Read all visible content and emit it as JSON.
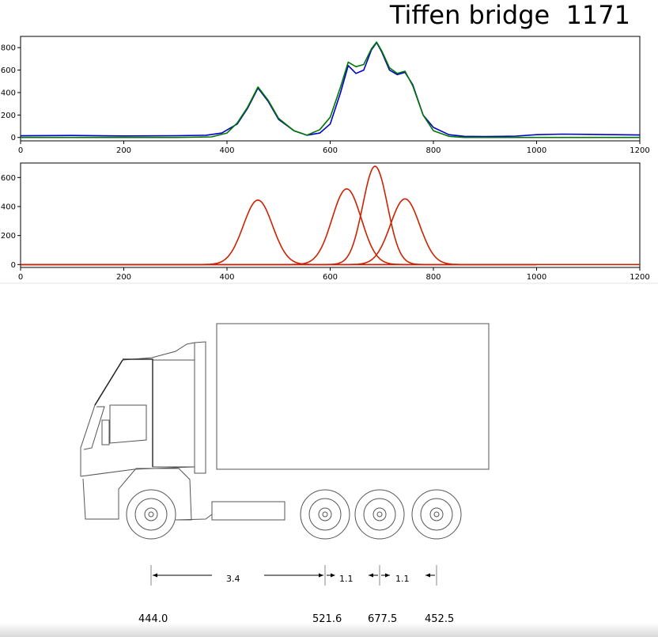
{
  "title": "Tiffen bridge  1171",
  "colors": {
    "measured": "#0000cc",
    "fitted": "#007700",
    "axle": "#cc2200",
    "baseline": "#000099",
    "truck": "#555555"
  },
  "chart_data": [
    {
      "type": "line",
      "xlim": [
        0,
        1200
      ],
      "ylim": [
        -30,
        900
      ],
      "x_ticks": [
        "0",
        "200",
        "400",
        "600",
        "800",
        "1000",
        "1200"
      ],
      "y_ticks": [
        "0",
        "200",
        "400",
        "600",
        "800"
      ],
      "series": [
        {
          "color": "#0000cc",
          "points": [
            [
              0,
              15
            ],
            [
              100,
              18
            ],
            [
              200,
              14
            ],
            [
              300,
              16
            ],
            [
              360,
              20
            ],
            [
              390,
              40
            ],
            [
              420,
              120
            ],
            [
              440,
              260
            ],
            [
              460,
              440
            ],
            [
              480,
              320
            ],
            [
              500,
              160
            ],
            [
              530,
              60
            ],
            [
              555,
              20
            ],
            [
              580,
              40
            ],
            [
              600,
              120
            ],
            [
              620,
              400
            ],
            [
              635,
              640
            ],
            [
              650,
              570
            ],
            [
              665,
              600
            ],
            [
              680,
              780
            ],
            [
              690,
              845
            ],
            [
              700,
              760
            ],
            [
              715,
              600
            ],
            [
              730,
              560
            ],
            [
              745,
              580
            ],
            [
              760,
              470
            ],
            [
              780,
              200
            ],
            [
              800,
              90
            ],
            [
              830,
              25
            ],
            [
              860,
              10
            ],
            [
              900,
              8
            ],
            [
              960,
              12
            ],
            [
              1000,
              25
            ],
            [
              1050,
              30
            ],
            [
              1100,
              28
            ],
            [
              1150,
              25
            ],
            [
              1200,
              22
            ]
          ]
        },
        {
          "color": "#007700",
          "points": [
            [
              0,
              0
            ],
            [
              300,
              0
            ],
            [
              370,
              5
            ],
            [
              400,
              40
            ],
            [
              420,
              130
            ],
            [
              440,
              270
            ],
            [
              460,
              450
            ],
            [
              480,
              330
            ],
            [
              500,
              170
            ],
            [
              530,
              60
            ],
            [
              555,
              20
            ],
            [
              580,
              70
            ],
            [
              600,
              180
            ],
            [
              620,
              450
            ],
            [
              635,
              670
            ],
            [
              650,
              630
            ],
            [
              665,
              650
            ],
            [
              680,
              790
            ],
            [
              690,
              850
            ],
            [
              700,
              770
            ],
            [
              715,
              620
            ],
            [
              730,
              570
            ],
            [
              745,
              590
            ],
            [
              760,
              460
            ],
            [
              780,
              200
            ],
            [
              800,
              60
            ],
            [
              830,
              10
            ],
            [
              860,
              0
            ],
            [
              1200,
              0
            ]
          ]
        }
      ]
    },
    {
      "type": "line",
      "xlim": [
        0,
        1200
      ],
      "ylim": [
        -20,
        700
      ],
      "x_ticks": [
        "0",
        "200",
        "400",
        "600",
        "800",
        "1000",
        "1200"
      ],
      "y_ticks": [
        "0",
        "200",
        "400",
        "600"
      ],
      "series": [
        {
          "color": "#000099",
          "points": [
            [
              0,
              0
            ],
            [
              1000,
              0
            ]
          ]
        },
        {
          "color": "#cc2200",
          "points": [
            [
              1000,
              0
            ],
            [
              1200,
              0
            ]
          ]
        },
        {
          "color": "#cc2200",
          "center": 460,
          "peak": 444,
          "width": 38
        },
        {
          "color": "#cc2200",
          "center": 632,
          "peak": 521.6,
          "width": 38
        },
        {
          "color": "#cc2200",
          "center": 687,
          "peak": 677.5,
          "width": 32
        },
        {
          "color": "#cc2200",
          "center": 745,
          "peak": 452.5,
          "width": 38
        }
      ]
    }
  ],
  "axle_spacing": [
    "3.4",
    "1.1",
    "1.1"
  ],
  "axle_loads": [
    "444.0",
    "521.6",
    "677.5",
    "452.5"
  ]
}
